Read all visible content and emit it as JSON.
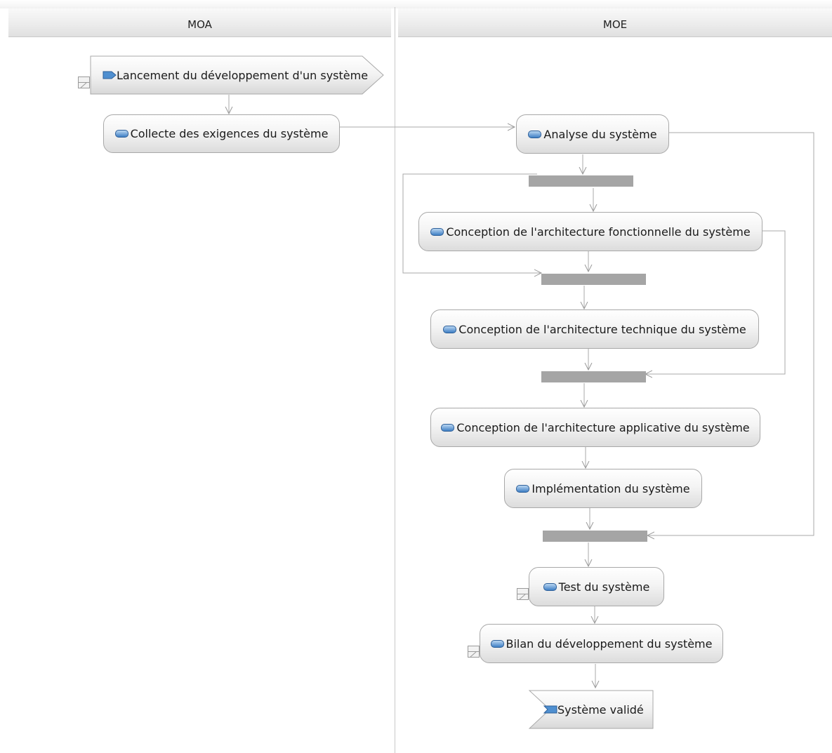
{
  "lanes": {
    "moa": "MOA",
    "moe": "MOE"
  },
  "nodes": {
    "start": "Lancement du développement d'un système",
    "collecte": "Collecte des exigences du système",
    "analyse": "Analyse du système",
    "conception_fonctionnelle": "Conception de l'architecture fonctionnelle du système",
    "conception_technique": "Conception de l'architecture technique du système",
    "conception_applicative": "Conception de l'architecture applicative du système",
    "implementation": "Implémentation du système",
    "test": "Test du système",
    "bilan": "Bilan du développement du système",
    "end": "Système validé"
  },
  "icons": {
    "action": "action-pill-icon",
    "send_signal": "send-signal-icon",
    "receive_signal": "receive-signal-icon",
    "annotation": "annotation-tag-icon"
  },
  "colors": {
    "sync_bar": "#a5a5a5",
    "connector": "#a0a0a0",
    "icon_blue": "#3f7fc4"
  }
}
